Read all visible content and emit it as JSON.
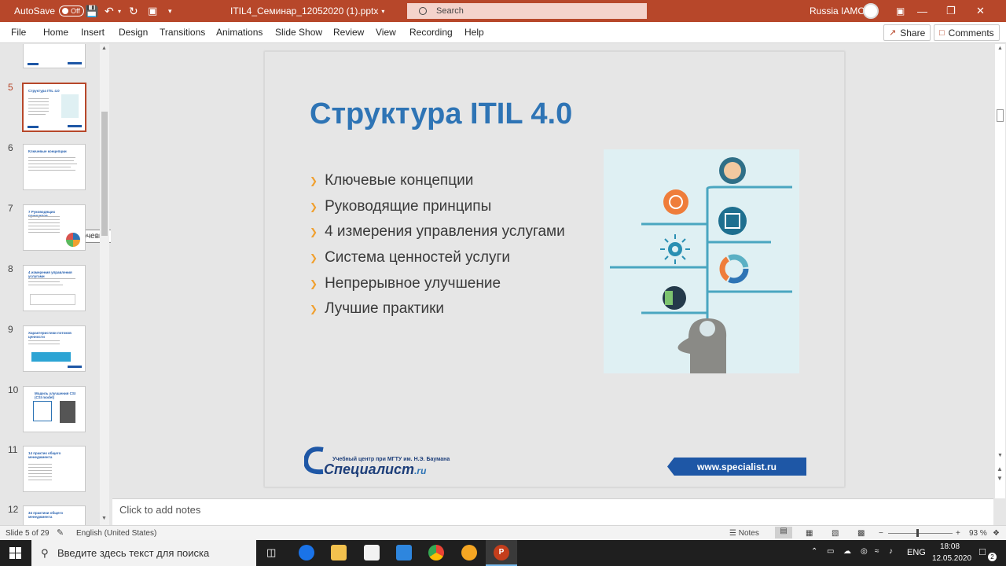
{
  "titlebar": {
    "autosave_label": "AutoSave",
    "autosave_state": "Off",
    "file_name": "ITIL4_Семинар_12052020 (1).pptx",
    "search_placeholder": "Search",
    "user_name": "Russia IAMCP"
  },
  "ribbon": {
    "tabs": [
      "File",
      "Home",
      "Insert",
      "Design",
      "Transitions",
      "Animations",
      "Slide Show",
      "Review",
      "View",
      "Recording",
      "Help"
    ],
    "share_label": "Share",
    "comments_label": "Comments"
  },
  "thumbnails": {
    "slides": [
      {
        "num": "5",
        "title": "Структура ITIL 4.0"
      },
      {
        "num": "6",
        "title": "Ключевые концепции"
      },
      {
        "num": "7",
        "title": "7 Руководящих принципов"
      },
      {
        "num": "8",
        "title": "4 измерения управления услугами"
      },
      {
        "num": "9",
        "title": "Характеристики потоков ценности"
      },
      {
        "num": "10",
        "title": "Модель улучшения CSI (CSI model)"
      },
      {
        "num": "11",
        "title": "14 практик общего менеджмента"
      },
      {
        "num": "12",
        "title": "34 практики общего менеджмента"
      }
    ],
    "selected": "5",
    "tooltip": "Ключевые концепции"
  },
  "slide": {
    "title": "Структура ITIL 4.0",
    "bullets": [
      "Ключевые концепции",
      "Руководящие принципы",
      "4 измерения управления услугами",
      "Система ценностей услуги",
      "Непрерывное улучшение",
      "Лучшие практики"
    ],
    "logo_caption": "Учебный центр при МГТУ им. Н.Э. Баумана",
    "logo_name": "Специалист",
    "logo_suffix": ".ru",
    "site": "www.specialist.ru"
  },
  "notes": {
    "placeholder": "Click to add notes"
  },
  "status": {
    "slide_counter": "Slide 5 of 29",
    "language": "English (United States)",
    "notes_label": "Notes",
    "zoom": "93 %"
  },
  "taskbar": {
    "search_placeholder": "Введите здесь текст для поиска",
    "lang": "ENG",
    "time": "18:08",
    "date": "12.05.2020",
    "notification_count": "2"
  },
  "colors": {
    "accent": "#b7472a",
    "title_blue": "#2e74b5",
    "bullet_orange": "#f0a030",
    "brand_blue": "#1e57a6"
  }
}
